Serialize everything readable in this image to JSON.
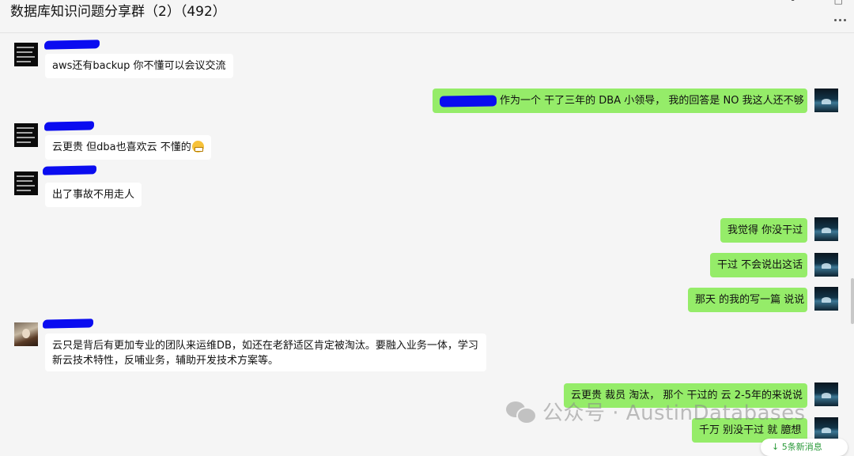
{
  "header": {
    "title": "数据库知识问题分享群（2）（492）",
    "win_minimize": "-",
    "win_close": "□",
    "more_icon": "more-dots"
  },
  "messages": [
    {
      "side": "in",
      "text": "aws还有backup 你不懂可以会议交流",
      "avatar": "text-avatar"
    },
    {
      "side": "out",
      "text": "作为一个 干了三年的  DBA 小领导， 我的回答是  NO  我这人还不够",
      "avatar": "sea-avatar",
      "mention_redacted": true
    },
    {
      "side": "in",
      "text": "云更贵 但dba也喜欢云 不懂的",
      "avatar": "text-avatar",
      "emoji": "grimacing-face"
    },
    {
      "side": "in",
      "text": "出了事故不用走人",
      "avatar": "text-avatar"
    },
    {
      "side": "out",
      "text": "我觉得 你没干过",
      "avatar": "sea-avatar"
    },
    {
      "side": "out",
      "text": "干过 不会说出这话",
      "avatar": "sea-avatar"
    },
    {
      "side": "out",
      "text": "那天 的我的写一篇 说说",
      "avatar": "sea-avatar"
    },
    {
      "side": "in",
      "text": "云只是背后有更加专业的团队来运维DB，如还在老舒适区肯定被淘汰。要融入业务一体，学习新云技术特性，反哺业务，辅助开发技术方案等。",
      "avatar": "photo-avatar"
    },
    {
      "side": "out",
      "text": "云更贵  裁员   淘汰， 那个 干过的 云 2-5年的来说说",
      "avatar": "sea-avatar"
    },
    {
      "side": "out",
      "text": "千万 别没干过 就  臆想",
      "avatar": "sea-avatar"
    }
  ],
  "watermark": "公众号 · AustinDatabases",
  "new_messages_pill": "↓ 5条新消息"
}
